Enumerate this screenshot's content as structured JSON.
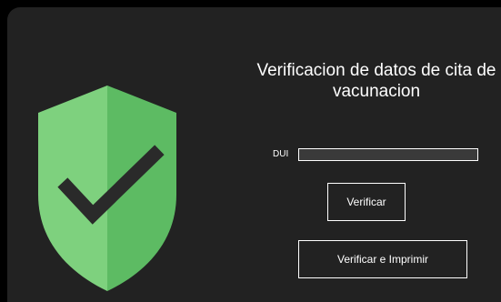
{
  "form": {
    "title": "Verificacion de datos de cita de vacunacion",
    "dui_label": "DUI",
    "dui_value": "",
    "verify_label": "Verificar",
    "verify_print_label": "Verificar e Imprimir"
  },
  "icons": {
    "hero": "shield-check-icon"
  },
  "colors": {
    "background": "#222222",
    "shield_light": "#7ed17e",
    "shield_dark": "#5dbb63",
    "check": "#2a2a2a",
    "text": "#ffffff"
  }
}
